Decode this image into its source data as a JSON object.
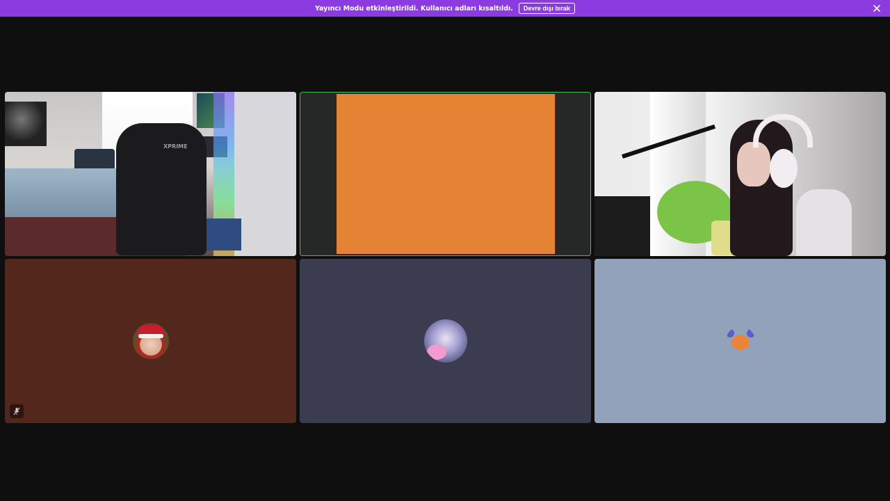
{
  "notice": {
    "message": "Yayıncı Modu etkinleştirildi. Kullanıcı adları kısaltıldı.",
    "disable_button": "Devre dışı bırak",
    "close_icon": "close-icon",
    "background": "#8b3be0"
  },
  "participants": [
    {
      "tile": "camera",
      "scene": "bedroom-gaming-chair",
      "chair_brand": "XPRIME"
    },
    {
      "tile": "screen",
      "speaking": true,
      "highlight_color": "#3fbf5a",
      "screen_color": "#e38333"
    },
    {
      "tile": "camera",
      "scene": "streamer-with-headphones"
    },
    {
      "tile": "avatar",
      "avatar": "santa-hat-avatar",
      "background": "#54271c",
      "muted": true,
      "mute_icon": "microphone-muted-icon"
    },
    {
      "tile": "avatar",
      "avatar": "anime-girl-avatar",
      "background": "#3c3c50"
    },
    {
      "tile": "avatar",
      "avatar": "crab-emoji-avatar",
      "background": "#92a2ba"
    }
  ]
}
